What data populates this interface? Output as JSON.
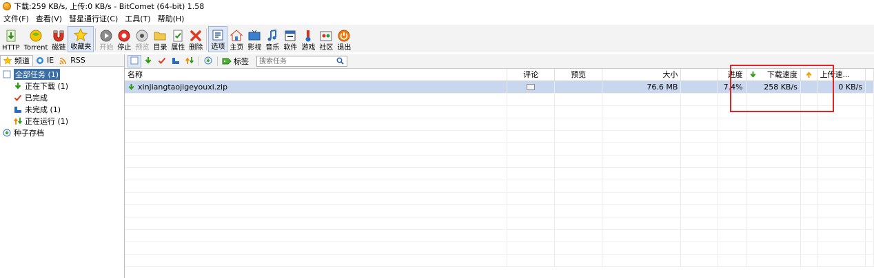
{
  "window": {
    "title": "下载:259 KB/s, 上传:0 KB/s - BitComet (64-bit) 1.58"
  },
  "menu": [
    "文件(F)",
    "查看(V)",
    "彗星通行证(C)",
    "工具(T)",
    "帮助(H)"
  ],
  "toolbar": {
    "buttons": [
      {
        "label": "HTTP",
        "icon": "http-download-icon"
      },
      {
        "label": "Torrent",
        "icon": "torrent-icon"
      },
      {
        "label": "磁链",
        "icon": "magnet-icon"
      },
      {
        "label": "收藏夹",
        "icon": "favorites-star-icon"
      },
      {
        "label": "开始",
        "icon": "start-icon"
      },
      {
        "label": "停止",
        "icon": "stop-icon"
      },
      {
        "label": "预览",
        "icon": "preview-icon"
      },
      {
        "label": "目录",
        "icon": "folder-icon"
      },
      {
        "label": "属性",
        "icon": "properties-icon"
      },
      {
        "label": "删除",
        "icon": "delete-x-icon"
      },
      {
        "label": "选项",
        "icon": "options-icon"
      },
      {
        "label": "主页",
        "icon": "home-icon"
      },
      {
        "label": "影视",
        "icon": "video-icon"
      },
      {
        "label": "音乐",
        "icon": "music-icon"
      },
      {
        "label": "软件",
        "icon": "software-icon"
      },
      {
        "label": "游戏",
        "icon": "game-icon"
      },
      {
        "label": "社区",
        "icon": "community-icon"
      },
      {
        "label": "退出",
        "icon": "power-icon"
      }
    ]
  },
  "left_tabs": [
    "频道",
    "IE",
    "RSS"
  ],
  "tree": {
    "all": "全部任务 (1)",
    "downloading": "正在下载 (1)",
    "completed": "已完成",
    "incomplete": "未完成 (1)",
    "running": "正在运行 (1)",
    "seed_archive": "种子存档"
  },
  "right_toolbar": {
    "tag_label": "标签",
    "search_placeholder": "搜索任务"
  },
  "table": {
    "headers": {
      "name": "名称",
      "comment": "评论",
      "preview": "预览",
      "size": "大小",
      "progress": "进度",
      "download_speed": "下载速度",
      "upload_speed": "上传速..."
    },
    "rows": [
      {
        "name": "xinjiangtaojigeyouxi.zip",
        "size": "76.6 MB",
        "progress": "7.4%",
        "download_speed": "258 KB/s",
        "upload_speed": "0 KB/s"
      }
    ]
  },
  "colors": {
    "highlight_box": "#e02424",
    "selection": "#3a6ea5",
    "row_selected": "#c9d7ee"
  }
}
